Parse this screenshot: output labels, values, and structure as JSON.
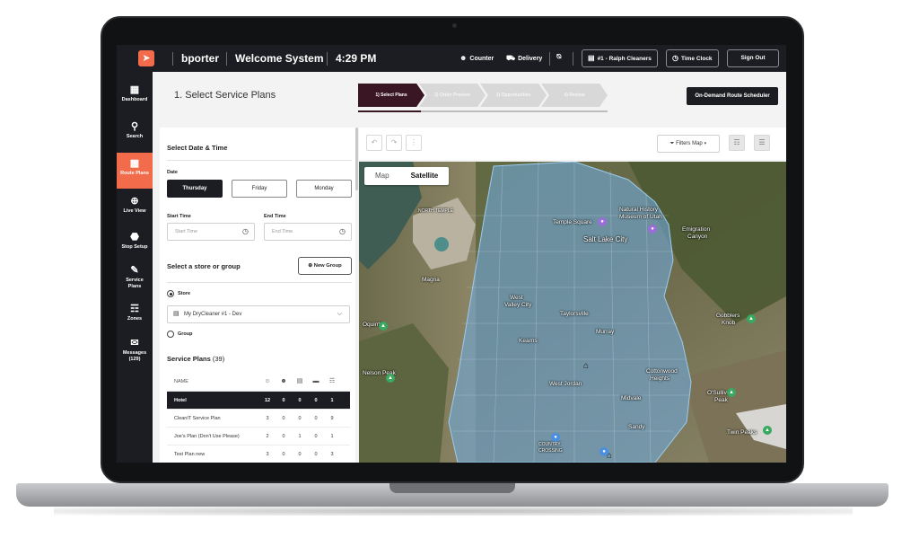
{
  "topbar": {
    "username": "bporter",
    "system": "Welcome System",
    "time": "4:29 PM",
    "counter_label": "Counter",
    "delivery_label": "Delivery",
    "store_button": "#1 - Ralph Cleaners",
    "time_clock_button": "Time Clock",
    "sign_out_button": "Sign Out"
  },
  "nav": {
    "items": [
      {
        "label": "Dashboard",
        "icon": "dashboard-icon"
      },
      {
        "label": "Search",
        "icon": "search-icon"
      },
      {
        "label": "Route Plans",
        "icon": "route-plans-icon"
      },
      {
        "label": "Live View",
        "icon": "crosshair-icon"
      },
      {
        "label": "Stop Setup",
        "icon": "stop-icon"
      },
      {
        "label": "Service",
        "label2": "Plans",
        "icon": "service-plans-icon"
      },
      {
        "label": "Zones",
        "icon": "map-icon"
      },
      {
        "label": "Messages",
        "label2": "(129)",
        "icon": "messages-icon"
      }
    ]
  },
  "header": {
    "title": "1. Select Service Plans",
    "steps": [
      "1) Select Plans",
      "2) Order Preview",
      "3) Opportunities",
      "4) Review"
    ],
    "on_demand_button": "On-Demand Route Scheduler"
  },
  "panel": {
    "date_time_heading": "Select Date & Time",
    "date_label": "Date",
    "days": [
      "Thursday",
      "Friday",
      "Monday"
    ],
    "start_time_label": "Start Time",
    "start_time_placeholder": "Start Time",
    "end_time_label": "End Time",
    "end_time_placeholder": "End Time",
    "store_group_heading": "Select a store or group",
    "new_group_button": "New Group",
    "store_radio": "Store",
    "store_select_value": "My DryCleaner #1 - Dev",
    "group_radio": "Group",
    "service_plans_heading": "Service Plans",
    "service_plans_count": "(39)",
    "table": {
      "name_header": "NAME",
      "rows": [
        {
          "name": "Hotel",
          "v": [
            "12",
            "0",
            "0",
            "0",
            "1"
          ]
        },
        {
          "name": "CleanIT Service Plan",
          "v": [
            "3",
            "0",
            "0",
            "0",
            "9"
          ]
        },
        {
          "name": "Joe's Plan (Don't Use Please)",
          "v": [
            "2",
            "0",
            "1",
            "0",
            "1"
          ]
        },
        {
          "name": "Test Plan new",
          "v": [
            "3",
            "0",
            "0",
            "0",
            "3"
          ]
        }
      ]
    }
  },
  "map": {
    "filters_label": "Filters Map",
    "map_tab": "Map",
    "satellite_tab": "Satellite",
    "labels": {
      "north_temple": "NORTH TEMPLE",
      "temple_square": "Temple Square",
      "natural_history": "Natural History",
      "museum_utah": "Museum of Utah",
      "salt_lake_city": "Salt Lake City",
      "emigration": "Emigration",
      "canyon": "Canyon",
      "magna": "Magna",
      "west_valley": "West",
      "valley_city": "Valley City",
      "taylorsville": "Taylorsville",
      "kearns": "Kearns",
      "murray": "Murray",
      "cottonwood": "Cottonwood",
      "heights": "Heights",
      "gobblers": "Gobblers",
      "knob": "Knob",
      "west_jordan": "West Jordan",
      "midvale": "Midvale",
      "sandy": "Sandy",
      "oquirrh": "Oquirrh",
      "nelson_peak": "Nelson Peak",
      "osullivan": "O'Sullivan",
      "peak": "Peak",
      "twin_peaks": "Twin Peaks",
      "country": "COUNTRY",
      "crossing": "CROSSING"
    }
  },
  "colors": {
    "accent": "#f26b4b",
    "dark": "#1c1d22",
    "step_active": "#3a1625",
    "zone_fill": "#6fa8d6"
  }
}
